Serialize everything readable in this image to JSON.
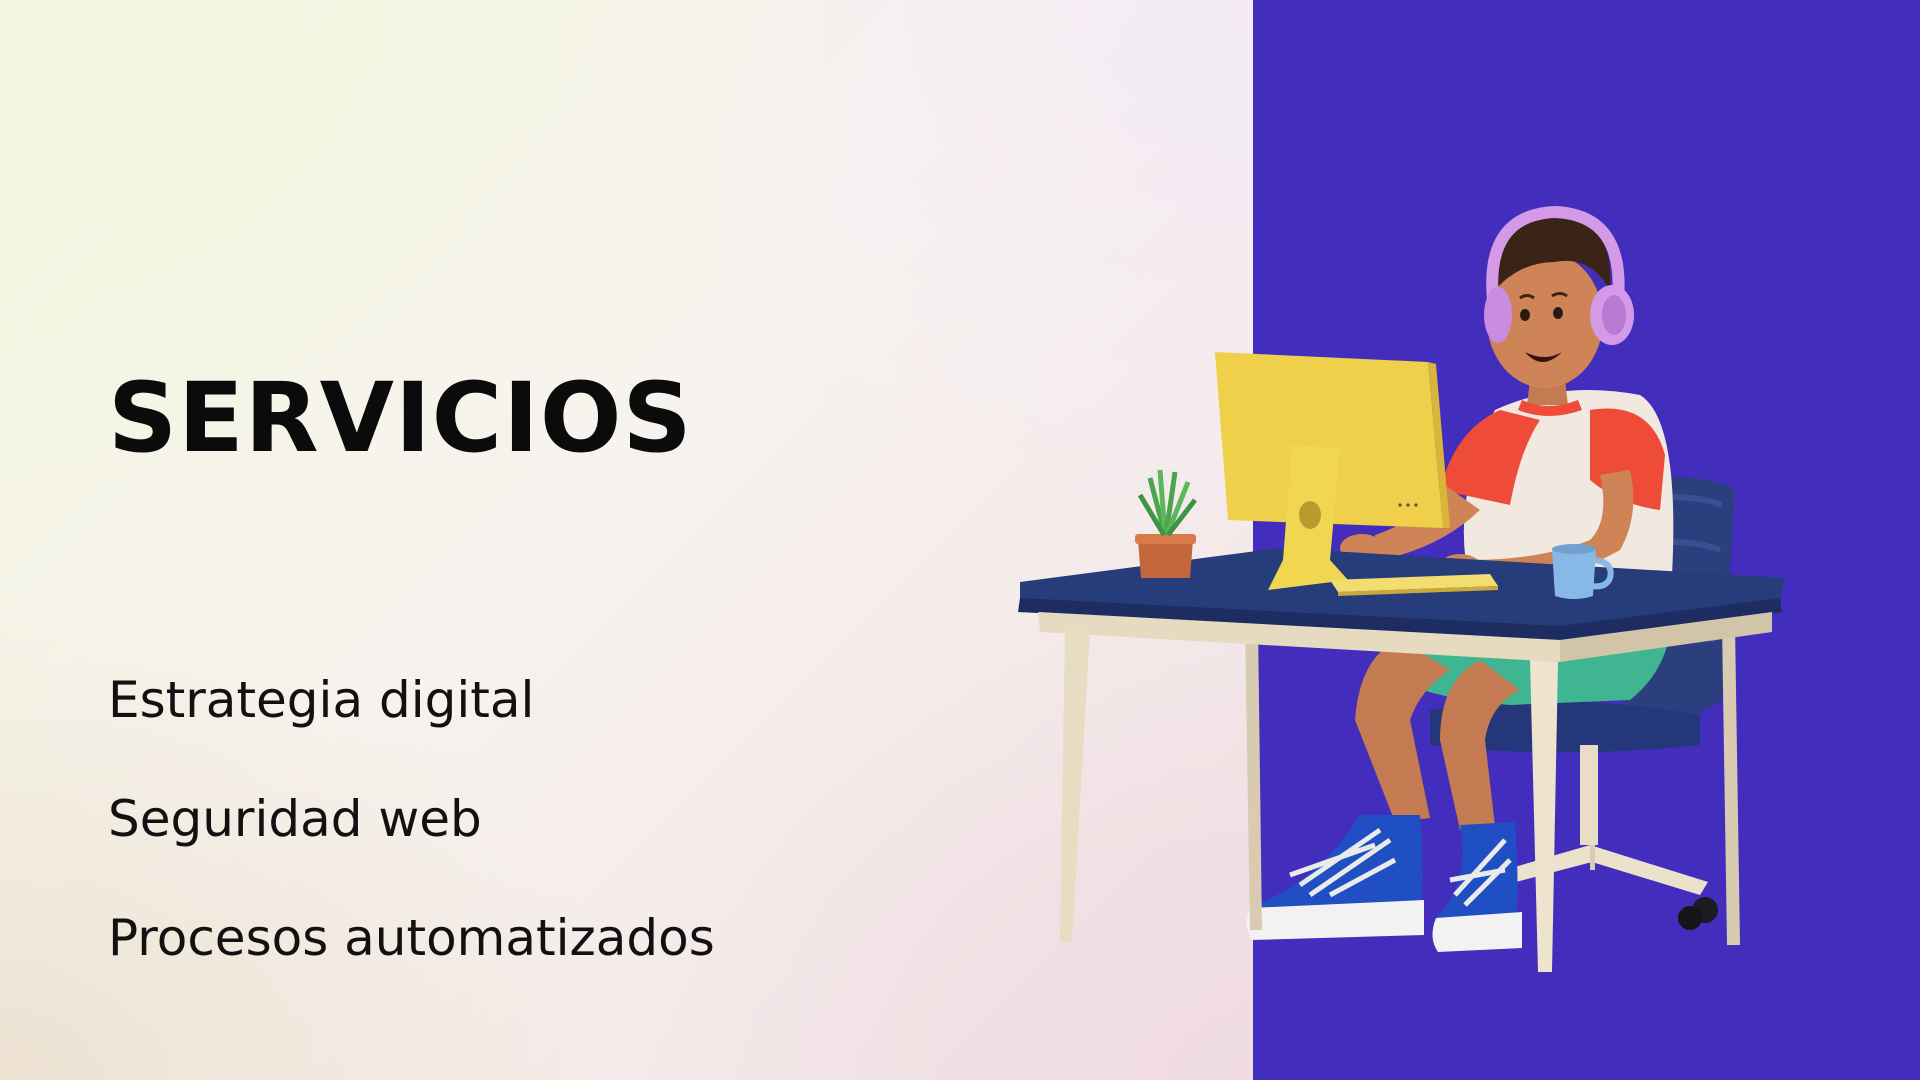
{
  "slide": {
    "title": "SERVICIOS",
    "services": [
      "Estrategia digital",
      "Seguridad web",
      "Procesos automatizados"
    ]
  },
  "colors": {
    "panel_blue": "#432dbc",
    "text": "#0b0b0b",
    "monitor_yellow": "#f0cf4a",
    "desk_navy": "#273c7a",
    "shirt_red": "#ee4b38",
    "headphones_lilac": "#d49ae8"
  },
  "illustration": {
    "subject": "person-at-desk-illustration"
  }
}
